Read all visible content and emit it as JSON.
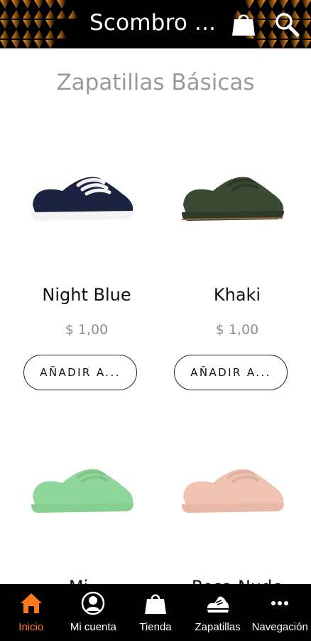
{
  "header": {
    "title": "Scombro ...",
    "icons": [
      "shopping-bag-icon",
      "search-icon"
    ],
    "accent_color": "#f7941d"
  },
  "section": {
    "title": "Zapatillas Básicas"
  },
  "products": [
    {
      "name": "Night Blue",
      "price": "$ 1,00",
      "button": "AÑADIR A...",
      "color": "#1c2341"
    },
    {
      "name": "Khaki",
      "price": "$ 1,00",
      "button": "AÑADIR A...",
      "color": "#3b4a32"
    },
    {
      "name": "Mi...",
      "price": "",
      "button": "",
      "color": "#8fd79b"
    },
    {
      "name": "Rosa Nude",
      "price": "",
      "button": "",
      "color": "#f0c2b2"
    }
  ],
  "bottom_nav": {
    "items": [
      {
        "label": "Inicio",
        "icon": "home-icon",
        "active": true
      },
      {
        "label": "Mi cuenta",
        "icon": "account-icon",
        "active": false
      },
      {
        "label": "Tienda",
        "icon": "shopping-bag-icon",
        "active": false
      },
      {
        "label": "Zapatillas",
        "icon": "sneaker-icon",
        "active": false
      },
      {
        "label": "Navegación",
        "icon": "more-icon",
        "active": false
      }
    ],
    "active_color": "#ff7a1a"
  }
}
